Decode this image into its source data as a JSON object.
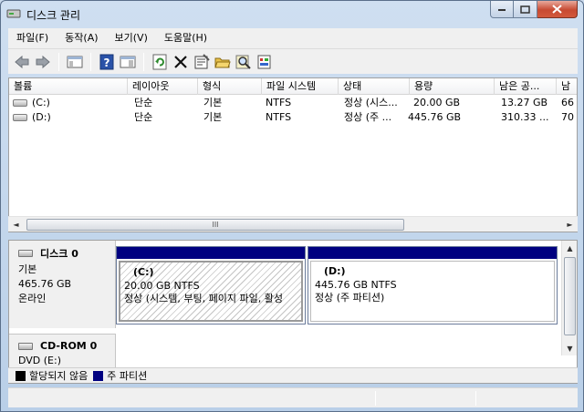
{
  "window": {
    "title": "디스크 관리"
  },
  "menu": [
    "파일(F)",
    "동작(A)",
    "보기(V)",
    "도움말(H)"
  ],
  "toolbar": {
    "buttons": [
      "back-icon",
      "forward-icon",
      "console-tree-icon",
      "help-icon",
      "action-pane-icon",
      "refresh-icon",
      "delete-icon",
      "properties-icon",
      "open-folder-icon",
      "search-icon",
      "settings-icon"
    ]
  },
  "volumes": {
    "columns": [
      "볼륨",
      "레이아웃",
      "형식",
      "파일 시스템",
      "상태",
      "용량",
      "남은 공...",
      "남"
    ],
    "rows": [
      {
        "name": "(C:)",
        "layout": "단순",
        "type": "기본",
        "fs": "NTFS",
        "status": "정상 (시스...",
        "capacity": "20.00 GB",
        "free": "13.27 GB",
        "pct": "66"
      },
      {
        "name": "(D:)",
        "layout": "단순",
        "type": "기본",
        "fs": "NTFS",
        "status": "정상 (주 ...",
        "capacity": "445.76 GB",
        "free": "310.33 ...",
        "pct": "70"
      }
    ],
    "scroll_grip": "III"
  },
  "disks": [
    {
      "name": "디스크 0",
      "type": "기본",
      "size": "465.76 GB",
      "state": "온라인",
      "partitions": [
        {
          "name": "(C:)",
          "size": "20.00 GB NTFS",
          "status": "정상 (시스템, 부팅, 페이지 파일, 활성"
        },
        {
          "name": "(D:)",
          "size": "445.76 GB NTFS",
          "status": "정상 (주 파티션)"
        }
      ]
    },
    {
      "name": "CD-ROM 0",
      "type": "DVD (E:)"
    }
  ],
  "legend": [
    {
      "label": "할당되지 않음",
      "color": "#000000"
    },
    {
      "label": "주 파티션",
      "color": "#000080"
    }
  ]
}
